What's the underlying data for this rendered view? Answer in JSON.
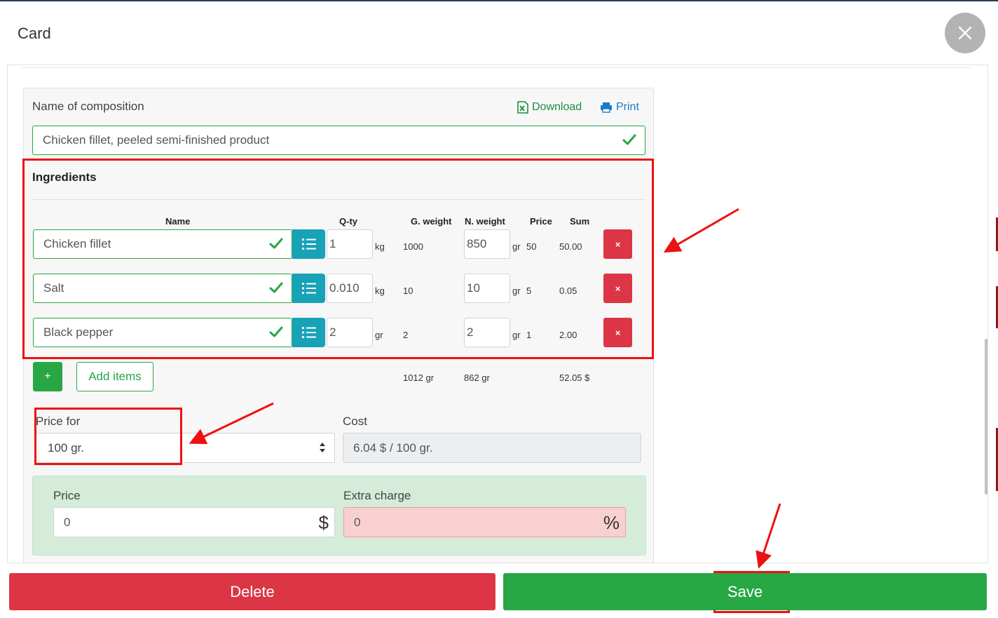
{
  "header": {
    "title": "Card"
  },
  "composition": {
    "name_label": "Name of composition",
    "name_value": "Chicken fillet, peeled semi-finished product",
    "download_label": "Download",
    "print_label": "Print"
  },
  "ingredients": {
    "title": "Ingredients",
    "columns": {
      "name": "Name",
      "qty": "Q-ty",
      "gross": "G. weight",
      "net": "N. weight",
      "price": "Price",
      "sum": "Sum"
    },
    "rows": [
      {
        "name": "Chicken fillet",
        "qty": "1",
        "qty_unit": "kg",
        "gross": "1000",
        "net": "850",
        "net_unit": "gr",
        "price": "50",
        "sum": "50.00"
      },
      {
        "name": "Salt",
        "qty": "0.010",
        "qty_unit": "kg",
        "gross": "10",
        "net": "10",
        "net_unit": "gr",
        "price": "5",
        "sum": "0.05"
      },
      {
        "name": "Black pepper",
        "qty": "2",
        "qty_unit": "gr",
        "gross": "2",
        "net": "2",
        "net_unit": "gr",
        "price": "1",
        "sum": "2.00"
      }
    ],
    "remove_glyph": "×",
    "add_glyph": "+",
    "add_items_label": "Add items",
    "totals": {
      "gross": "1012 gr",
      "net": "862 gr",
      "sum": "52.05 $"
    }
  },
  "pricing": {
    "price_for_label": "Price for",
    "price_for_value": "100 gr.",
    "cost_label": "Cost",
    "cost_value": "6.04 $ / 100 gr.",
    "price_label": "Price",
    "price_value": "0",
    "price_suffix": "$",
    "extra_label": "Extra charge",
    "extra_value": "0",
    "extra_suffix": "%"
  },
  "footer": {
    "delete_label": "Delete",
    "save_label": "Save"
  },
  "colors": {
    "success": "#28a745",
    "danger": "#dc3545",
    "info": "#17a2b8",
    "annotation": "#ee1111"
  },
  "icons": [
    "close-icon",
    "excel-icon",
    "printer-icon",
    "check-icon",
    "list-icon",
    "select-arrows-icon"
  ]
}
